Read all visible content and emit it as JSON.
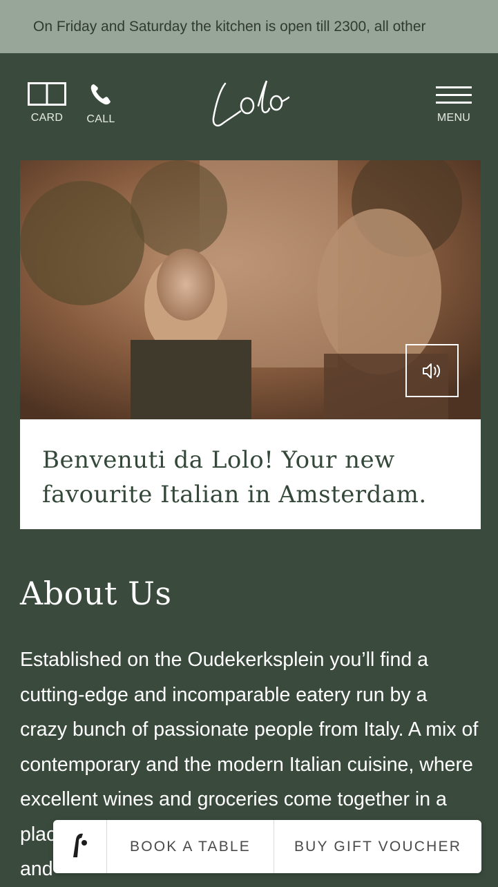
{
  "announcement": "On Friday and Saturday the kitchen is open till 2300, all other",
  "header": {
    "card_label": "CARD",
    "call_label": "CALL",
    "menu_label": "MENU",
    "logo_text": "Lolo"
  },
  "hero": {
    "welcome_text": "Benvenuti da Lolo! Your new favourite Italian in Amsterdam."
  },
  "about": {
    "title": "About Us",
    "body": "Established on the Oudekerksplein you’ll find a cutting-edge and incomparable eatery run by a crazy bunch of passionate people from Italy. A mix of contemporary and the modern Italian cuisine, where excellent wines and groceries come together in a place out of the ordinary, yet homelike. Joyful, lush and"
  },
  "booking_bar": {
    "book_label": "BOOK A TABLE",
    "gift_label": "BUY GIFT VOUCHER"
  },
  "colors": {
    "background": "#3a4b3d",
    "announcement_bg": "#98a69a",
    "heading_green": "#34483a"
  },
  "icons": [
    "card-icon",
    "phone-icon",
    "hamburger-menu-icon",
    "speaker-icon",
    "formitable-logo-icon"
  ]
}
